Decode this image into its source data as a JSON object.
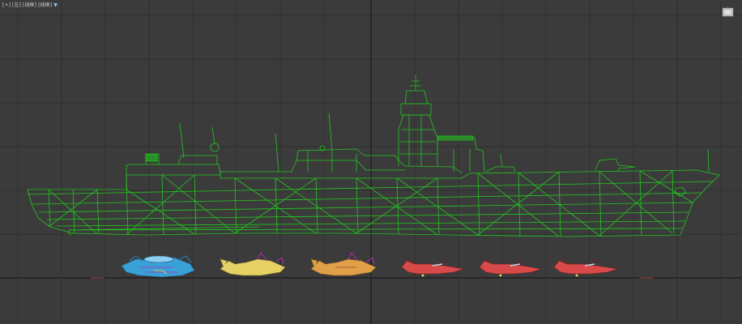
{
  "viewport": {
    "label": "[+] [左] [线框] [线框]",
    "label_menu_icon": "funnel-icon",
    "viewcube_icon": "viewcube-icon",
    "colors": {
      "background": "#3b3b3b",
      "grid": "#2e2e2e",
      "ship_wireframe": "#22c81e",
      "aircraft_blue": "#3aa0d8",
      "aircraft_yellow": "#e6d264",
      "aircraft_orange": "#e0a048",
      "aircraft_red": "#d84a4a"
    }
  },
  "scene": {
    "ship": "destroyer-wireframe",
    "aircraft": [
      {
        "kind": "awacs-aircraft",
        "color": "blue"
      },
      {
        "kind": "ew-aircraft",
        "color": "yellow"
      },
      {
        "kind": "ew-aircraft",
        "color": "orange"
      },
      {
        "kind": "fighter-jet",
        "color": "red"
      },
      {
        "kind": "fighter-jet",
        "color": "red"
      },
      {
        "kind": "fighter-jet",
        "color": "red"
      }
    ]
  }
}
